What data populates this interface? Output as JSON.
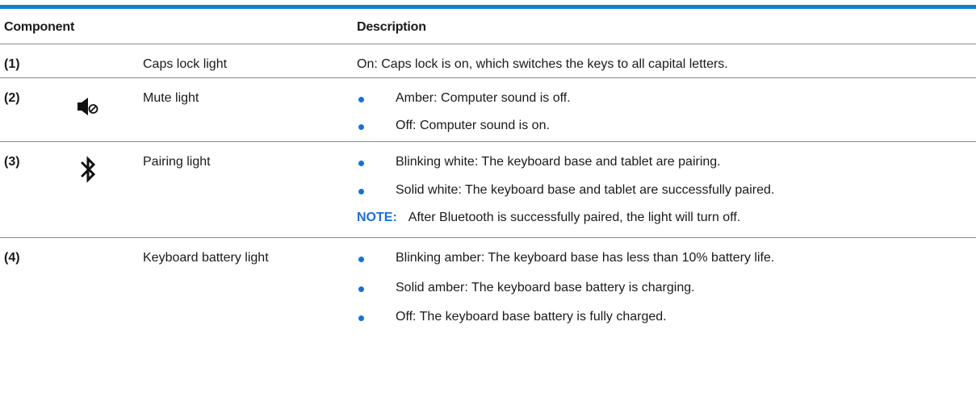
{
  "table": {
    "headers": {
      "component": "Component",
      "description": "Description"
    },
    "rows": [
      {
        "number": "(1)",
        "icon": "",
        "name": "Caps lock light",
        "description": "On: Caps lock is on, which switches the keys to all capital letters.",
        "bullets": []
      },
      {
        "number": "(2)",
        "icon": "mute-speaker-icon",
        "name": "Mute light",
        "bullets": [
          "Amber: Computer sound is off.",
          "Off: Computer sound is on."
        ]
      },
      {
        "number": "(3)",
        "icon": "bluetooth-icon",
        "name": "Pairing light",
        "bullets": [
          "Blinking white: The keyboard base and tablet are pairing.",
          "Solid white: The keyboard base and tablet are successfully paired."
        ],
        "note_label": "NOTE:",
        "note_text": "After Bluetooth is successfully paired, the light will turn off."
      },
      {
        "number": "(4)",
        "icon": "",
        "name": "Keyboard battery light",
        "bullets": [
          "Blinking amber: The keyboard base has less than 10% battery life.",
          "Solid amber: The keyboard base battery is charging.",
          "Off: The keyboard base battery is fully charged."
        ]
      }
    ]
  },
  "colors": {
    "accent": "#0e7fd6",
    "bullet": "#1b6fd1",
    "note": "#1b6fd1",
    "rule": "#8a8a8a"
  }
}
